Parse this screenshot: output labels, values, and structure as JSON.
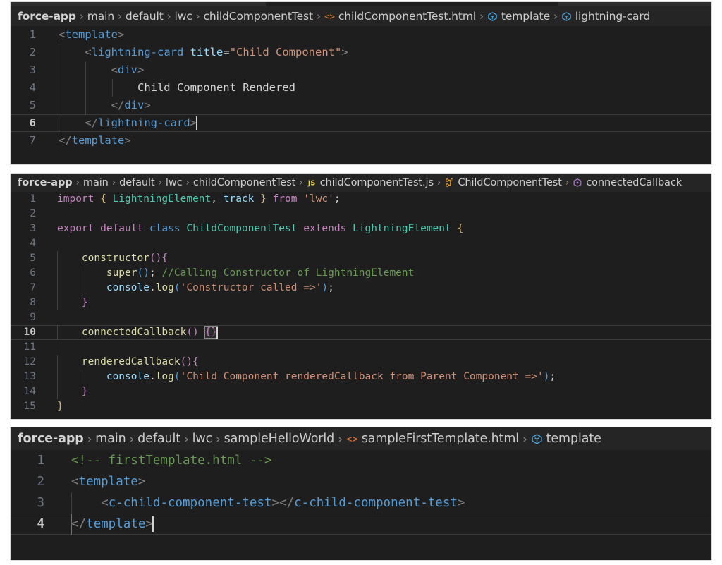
{
  "panels": [
    {
      "id": "child-template-html",
      "breadcrumb": [
        {
          "label": "force-app",
          "icon": null,
          "first": true
        },
        {
          "label": "main",
          "icon": null
        },
        {
          "label": "default",
          "icon": null
        },
        {
          "label": "lwc",
          "icon": null
        },
        {
          "label": "childComponentTest",
          "icon": null
        },
        {
          "label": "childComponentTest.html",
          "icon": "html-file-icon"
        },
        {
          "label": "template",
          "icon": "html-tag-symbol-icon"
        },
        {
          "label": "lightning-card",
          "icon": "html-tag-symbol-icon"
        }
      ],
      "lines": [
        {
          "n": "1",
          "active": false
        },
        {
          "n": "2",
          "active": false
        },
        {
          "n": "3",
          "active": false
        },
        {
          "n": "4",
          "active": false
        },
        {
          "n": "5",
          "active": false
        },
        {
          "n": "6",
          "active": true
        },
        {
          "n": "7",
          "active": false
        }
      ],
      "code_text": [
        "<template>",
        "    <lightning-card title=\"Child Component\">",
        "        <div>",
        "            Child Component Rendered",
        "        </div>",
        "    </lightning-card>",
        "</template>"
      ]
    },
    {
      "id": "child-component-js",
      "breadcrumb": [
        {
          "label": "force-app",
          "icon": null,
          "first": true
        },
        {
          "label": "main",
          "icon": null
        },
        {
          "label": "default",
          "icon": null
        },
        {
          "label": "lwc",
          "icon": null
        },
        {
          "label": "childComponentTest",
          "icon": null
        },
        {
          "label": "childComponentTest.js",
          "icon": "js-file-icon"
        },
        {
          "label": "ChildComponentTest",
          "icon": "class-symbol-icon"
        },
        {
          "label": "connectedCallback",
          "icon": "method-symbol-icon"
        }
      ],
      "lines": [
        {
          "n": "1",
          "active": false
        },
        {
          "n": "2",
          "active": false
        },
        {
          "n": "3",
          "active": false
        },
        {
          "n": "4",
          "active": false
        },
        {
          "n": "5",
          "active": false
        },
        {
          "n": "6",
          "active": false
        },
        {
          "n": "7",
          "active": false
        },
        {
          "n": "8",
          "active": false
        },
        {
          "n": "9",
          "active": false
        },
        {
          "n": "10",
          "active": true
        },
        {
          "n": "11",
          "active": false
        },
        {
          "n": "12",
          "active": false
        },
        {
          "n": "13",
          "active": false
        },
        {
          "n": "14",
          "active": false
        },
        {
          "n": "15",
          "active": false
        }
      ],
      "code_text": [
        "import { LightningElement, track } from 'lwc';",
        "",
        "export default class ChildComponentTest extends LightningElement {",
        "",
        "    constructor(){",
        "        super(); //Calling Constructor of LightningElement",
        "        console.log('Constructor called =>');",
        "    }",
        "",
        "    connectedCallback() {}",
        "",
        "    renderedCallback(){",
        "        console.log('Child Component renderedCallback from Parent Component =>');",
        "    }",
        "}"
      ]
    },
    {
      "id": "sample-first-template-html",
      "breadcrumb": [
        {
          "label": "force-app",
          "icon": null,
          "first": true
        },
        {
          "label": "main",
          "icon": null
        },
        {
          "label": "default",
          "icon": null
        },
        {
          "label": "lwc",
          "icon": null
        },
        {
          "label": "sampleHelloWorld",
          "icon": null
        },
        {
          "label": "sampleFirstTemplate.html",
          "icon": "html-file-icon"
        },
        {
          "label": "template",
          "icon": "html-tag-symbol-icon"
        }
      ],
      "lines": [
        {
          "n": "1",
          "active": false
        },
        {
          "n": "2",
          "active": false
        },
        {
          "n": "3",
          "active": false
        },
        {
          "n": "4",
          "active": true
        }
      ],
      "code_text": [
        "<!-- firstTemplate.html -->",
        "<template>",
        "    <c-child-component-test></c-child-component-test>",
        "</template>"
      ]
    }
  ],
  "tokens": {
    "p1": {
      "l1_open": "<",
      "l1_tag": "template",
      "l1_close": ">",
      "l2_open": "<",
      "l2_tag": "lightning-card",
      "l2_space": " ",
      "l2_attr": "title",
      "l2_eq": "=",
      "l2_str": "\"Child Component\"",
      "l2_close": ">",
      "l3_open": "<",
      "l3_tag": "div",
      "l3_close": ">",
      "l4_text": "Child Component Rendered",
      "l5_open": "</",
      "l5_tag": "div",
      "l5_close": ">",
      "l6_open": "</",
      "l6_tag": "lightning-card",
      "l6_close": ">",
      "l7_open": "</",
      "l7_tag": "template",
      "l7_close": ">"
    },
    "p2": {
      "l1_import": "import",
      "l1_brace_open": "{",
      "l1_le": " LightningElement",
      "l1_comma": ",",
      "l1_track": " track ",
      "l1_brace_close": "}",
      "l1_from": " from ",
      "l1_mod": "'lwc'",
      "l1_semi": ";",
      "l3_export": "export",
      "l3_default": " default ",
      "l3_class": "class",
      "l3_name": " ChildComponentTest ",
      "l3_extends": "extends",
      "l3_super": " LightningElement ",
      "l3_brace": "{",
      "l5_ctor": "constructor",
      "l5_paren": "()",
      "l5_brace": "{",
      "l6_super": "super",
      "l6_paren": "()",
      "l6_semi": "; ",
      "l6_comment": "//Calling Constructor of LightningElement",
      "l7_console": "console",
      "l7_dot": ".",
      "l7_log": "log",
      "l7_paren_open": "(",
      "l7_str": "'Constructor called =>'",
      "l7_paren_close": ")",
      "l7_semi": ";",
      "l8_brace": "}",
      "l10_name": "connectedCallback",
      "l10_paren": "()",
      "l10_space": " ",
      "l10_braces": "{}",
      "l12_name": "renderedCallback",
      "l12_paren": "()",
      "l12_brace": "{",
      "l13_console": "console",
      "l13_dot": ".",
      "l13_log": "log",
      "l13_paren_open": "(",
      "l13_str": "'Child Component renderedCallback from Parent Component =>'",
      "l13_paren_close": ")",
      "l13_semi": ";",
      "l14_brace": "}",
      "l15_brace": "}"
    },
    "p3": {
      "l1_comment": "<!-- firstTemplate.html -->",
      "l2_open": "<",
      "l2_tag": "template",
      "l2_close": ">",
      "l3_open": "<",
      "l3_tag": "c-child-component-test",
      "l3_close": ">",
      "l3_open2": "</",
      "l3_tag2": "c-child-component-test",
      "l3_close2": ">",
      "l4_open": "</",
      "l4_tag": "template",
      "l4_close": ">"
    }
  },
  "colors": {
    "editor_bg": "#1e1e1e",
    "breadcrumb_bg": "#252526",
    "page_bg": "#ffffff",
    "line_number": "#6e7681",
    "tag": "#569cd6",
    "attribute": "#9cdcfe",
    "string": "#ce9178",
    "keyword": "#c586c0",
    "type": "#4ec9b0",
    "function": "#dcdcaa",
    "comment": "#6a9955",
    "text": "#d4d4d4",
    "js_icon": "#f0db4f",
    "html_icon": "#e37933",
    "class_icon": "#ee9d28",
    "method_icon": "#b180d7",
    "template_icon": "#4aa8e0"
  }
}
